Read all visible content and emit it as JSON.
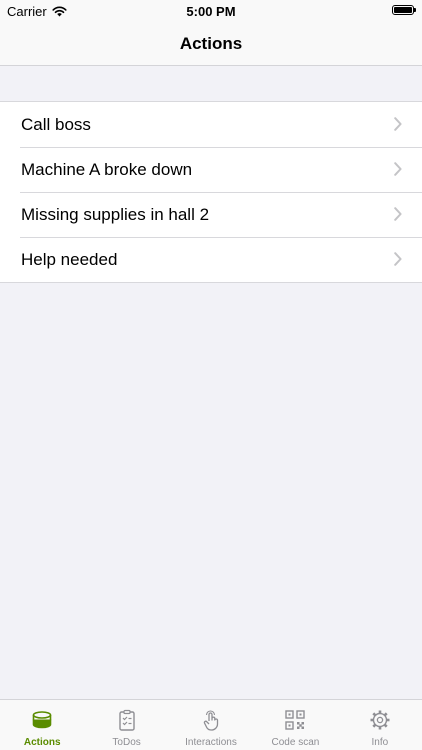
{
  "status_bar": {
    "carrier": "Carrier",
    "time": "5:00 PM"
  },
  "nav": {
    "title": "Actions"
  },
  "actions": [
    {
      "label": "Call boss"
    },
    {
      "label": "Machine A broke down"
    },
    {
      "label": "Missing supplies in hall 2"
    },
    {
      "label": "Help needed"
    }
  ],
  "tabs": [
    {
      "label": "Actions",
      "icon": "stack-icon",
      "active": true
    },
    {
      "label": "ToDos",
      "icon": "clipboard-checklist-icon",
      "active": false
    },
    {
      "label": "Interactions",
      "icon": "hand-tap-icon",
      "active": false
    },
    {
      "label": "Code scan",
      "icon": "qr-code-icon",
      "active": false
    },
    {
      "label": "Info",
      "icon": "gear-icon",
      "active": false
    }
  ],
  "colors": {
    "accent": "#5a8c00",
    "inactive": "#8e8e93",
    "background": "#f2f2f7"
  }
}
